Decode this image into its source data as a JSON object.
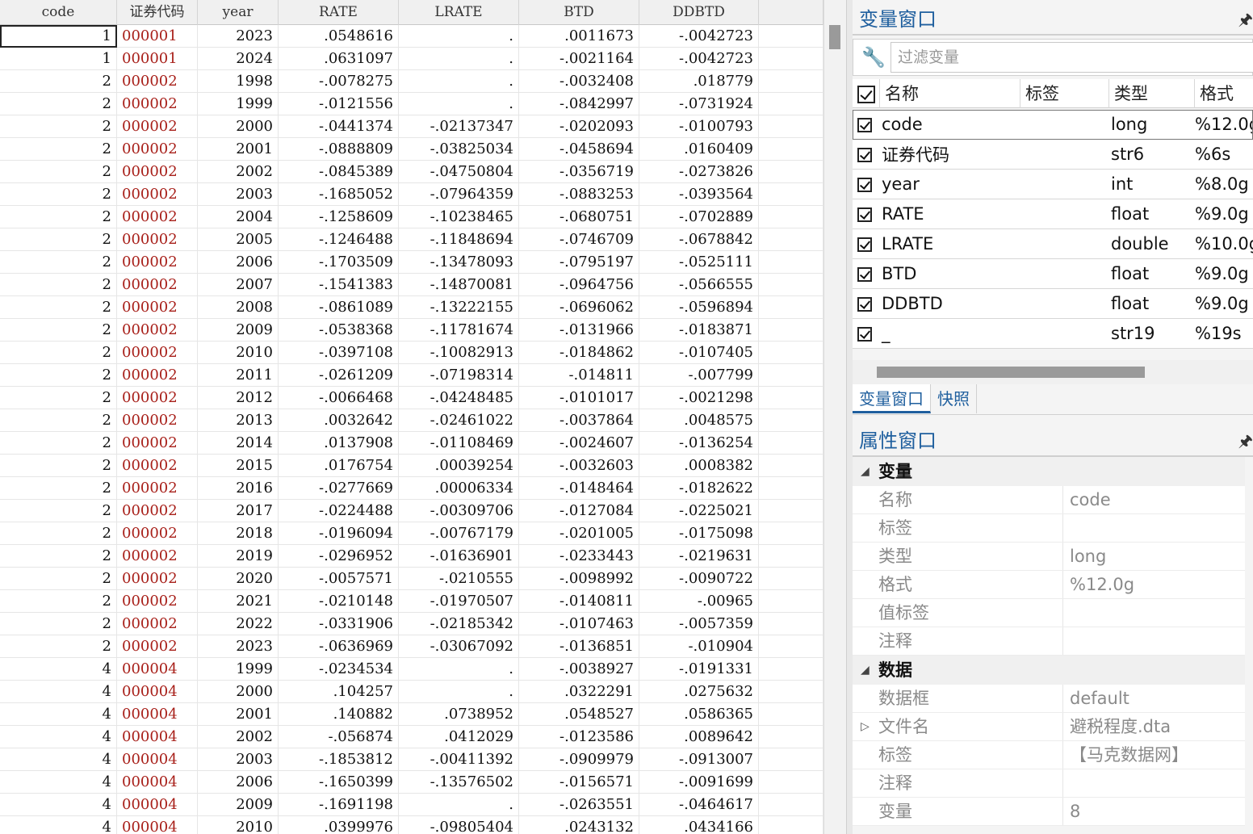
{
  "grid": {
    "columns": [
      "code",
      "证券代码",
      "year",
      "RATE",
      "LRATE",
      "BTD",
      "DDBTD",
      ""
    ],
    "rows": [
      [
        "1",
        "000001",
        "2023",
        ".0548616",
        ".",
        ".0011673",
        "-.0042723"
      ],
      [
        "1",
        "000001",
        "2024",
        ".0631097",
        ".",
        "-.0021164",
        "-.0042723"
      ],
      [
        "2",
        "000002",
        "1998",
        "-.0078275",
        ".",
        "-.0032408",
        ".018779"
      ],
      [
        "2",
        "000002",
        "1999",
        "-.0121556",
        ".",
        "-.0842997",
        "-.0731924"
      ],
      [
        "2",
        "000002",
        "2000",
        "-.0441374",
        "-.02137347",
        "-.0202093",
        "-.0100793"
      ],
      [
        "2",
        "000002",
        "2001",
        "-.0888809",
        "-.03825034",
        "-.0458694",
        ".0160409"
      ],
      [
        "2",
        "000002",
        "2002",
        "-.0845389",
        "-.04750804",
        "-.0356719",
        "-.0273826"
      ],
      [
        "2",
        "000002",
        "2003",
        "-.1685052",
        "-.07964359",
        "-.0883253",
        "-.0393564"
      ],
      [
        "2",
        "000002",
        "2004",
        "-.1258609",
        "-.10238465",
        "-.0680751",
        "-.0702889"
      ],
      [
        "2",
        "000002",
        "2005",
        "-.1246488",
        "-.11848694",
        "-.0746709",
        "-.0678842"
      ],
      [
        "2",
        "000002",
        "2006",
        "-.1703509",
        "-.13478093",
        "-.0795197",
        "-.0525111"
      ],
      [
        "2",
        "000002",
        "2007",
        "-.1541383",
        "-.14870081",
        "-.0964756",
        "-.0566555"
      ],
      [
        "2",
        "000002",
        "2008",
        "-.0861089",
        "-.13222155",
        "-.0696062",
        "-.0596894"
      ],
      [
        "2",
        "000002",
        "2009",
        "-.0538368",
        "-.11781674",
        "-.0131966",
        "-.0183871"
      ],
      [
        "2",
        "000002",
        "2010",
        "-.0397108",
        "-.10082913",
        "-.0184862",
        "-.0107405"
      ],
      [
        "2",
        "000002",
        "2011",
        "-.0261209",
        "-.07198314",
        "-.014811",
        "-.007799"
      ],
      [
        "2",
        "000002",
        "2012",
        "-.0066468",
        "-.04248485",
        "-.0101017",
        "-.0021298"
      ],
      [
        "2",
        "000002",
        "2013",
        ".0032642",
        "-.02461022",
        "-.0037864",
        ".0048575"
      ],
      [
        "2",
        "000002",
        "2014",
        ".0137908",
        "-.01108469",
        "-.0024607",
        "-.0136254"
      ],
      [
        "2",
        "000002",
        "2015",
        ".0176754",
        ".00039254",
        "-.0032603",
        ".0008382"
      ],
      [
        "2",
        "000002",
        "2016",
        "-.0277669",
        ".00006334",
        "-.0148464",
        "-.0182622"
      ],
      [
        "2",
        "000002",
        "2017",
        "-.0224488",
        "-.00309706",
        "-.0127084",
        "-.0225021"
      ],
      [
        "2",
        "000002",
        "2018",
        "-.0196094",
        "-.00767179",
        "-.0201005",
        "-.0175098"
      ],
      [
        "2",
        "000002",
        "2019",
        "-.0296952",
        "-.01636901",
        "-.0233443",
        "-.0219631"
      ],
      [
        "2",
        "000002",
        "2020",
        "-.0057571",
        "-.0210555",
        "-.0098992",
        "-.0090722"
      ],
      [
        "2",
        "000002",
        "2021",
        "-.0210148",
        "-.01970507",
        "-.0140811",
        "-.00965"
      ],
      [
        "2",
        "000002",
        "2022",
        "-.0331906",
        "-.02185342",
        "-.0107463",
        "-.0057359"
      ],
      [
        "2",
        "000002",
        "2023",
        "-.0636969",
        "-.03067092",
        "-.0136851",
        "-.010904"
      ],
      [
        "4",
        "000004",
        "1999",
        "-.0234534",
        ".",
        "-.0038927",
        "-.0191331"
      ],
      [
        "4",
        "000004",
        "2000",
        ".104257",
        ".",
        ".0322291",
        ".0275632"
      ],
      [
        "4",
        "000004",
        "2001",
        ".140882",
        ".0738952",
        ".0548527",
        ".0586365"
      ],
      [
        "4",
        "000004",
        "2002",
        "-.056874",
        ".0412029",
        "-.0123586",
        ".0089642"
      ],
      [
        "4",
        "000004",
        "2003",
        "-.1853812",
        "-.00411392",
        "-.0909979",
        "-.0913007"
      ],
      [
        "4",
        "000004",
        "2006",
        "-.1650399",
        "-.13576502",
        "-.0156571",
        "-.0091699"
      ],
      [
        "4",
        "000004",
        "2009",
        "-.1691198",
        ".",
        "-.0263551",
        "-.0464617"
      ],
      [
        "4",
        "000004",
        "2010",
        ".0399976",
        "-.09805404",
        ".0243132",
        ".0434166"
      ]
    ]
  },
  "variables_window": {
    "title": "变量窗口",
    "pin_icon": "pin-icon",
    "filter_placeholder": "过滤变量",
    "headers": {
      "name": "名称",
      "label": "标签",
      "type": "类型",
      "format": "格式"
    },
    "variables": [
      {
        "name": "code",
        "type": "long",
        "format": "%12.0g"
      },
      {
        "name": "证券代码",
        "type": "str6",
        "format": "%6s"
      },
      {
        "name": "year",
        "type": "int",
        "format": "%8.0g"
      },
      {
        "name": "RATE",
        "type": "float",
        "format": "%9.0g"
      },
      {
        "name": "LRATE",
        "type": "double",
        "format": "%10.0g"
      },
      {
        "name": "BTD",
        "type": "float",
        "format": "%9.0g"
      },
      {
        "name": "DDBTD",
        "type": "float",
        "format": "%9.0g"
      },
      {
        "name": "_",
        "type": "str19",
        "format": "%19s"
      }
    ]
  },
  "tabs": [
    "变量窗口",
    "快照"
  ],
  "properties_window": {
    "title": "属性窗口",
    "groups": [
      {
        "name": "变量",
        "rows": [
          {
            "key": "名称",
            "value": "code"
          },
          {
            "key": "标签",
            "value": ""
          },
          {
            "key": "类型",
            "value": "long"
          },
          {
            "key": "格式",
            "value": "%12.0g"
          },
          {
            "key": "值标签",
            "value": ""
          },
          {
            "key": "注释",
            "value": ""
          }
        ]
      },
      {
        "name": "数据",
        "rows": [
          {
            "key": "数据框",
            "value": "default"
          },
          {
            "key": "文件名",
            "value": "避税程度.dta"
          },
          {
            "key": "标签",
            "value": "【马克数据网】"
          },
          {
            "key": "注释",
            "value": ""
          },
          {
            "key": "变量",
            "value": "8"
          }
        ]
      }
    ]
  }
}
